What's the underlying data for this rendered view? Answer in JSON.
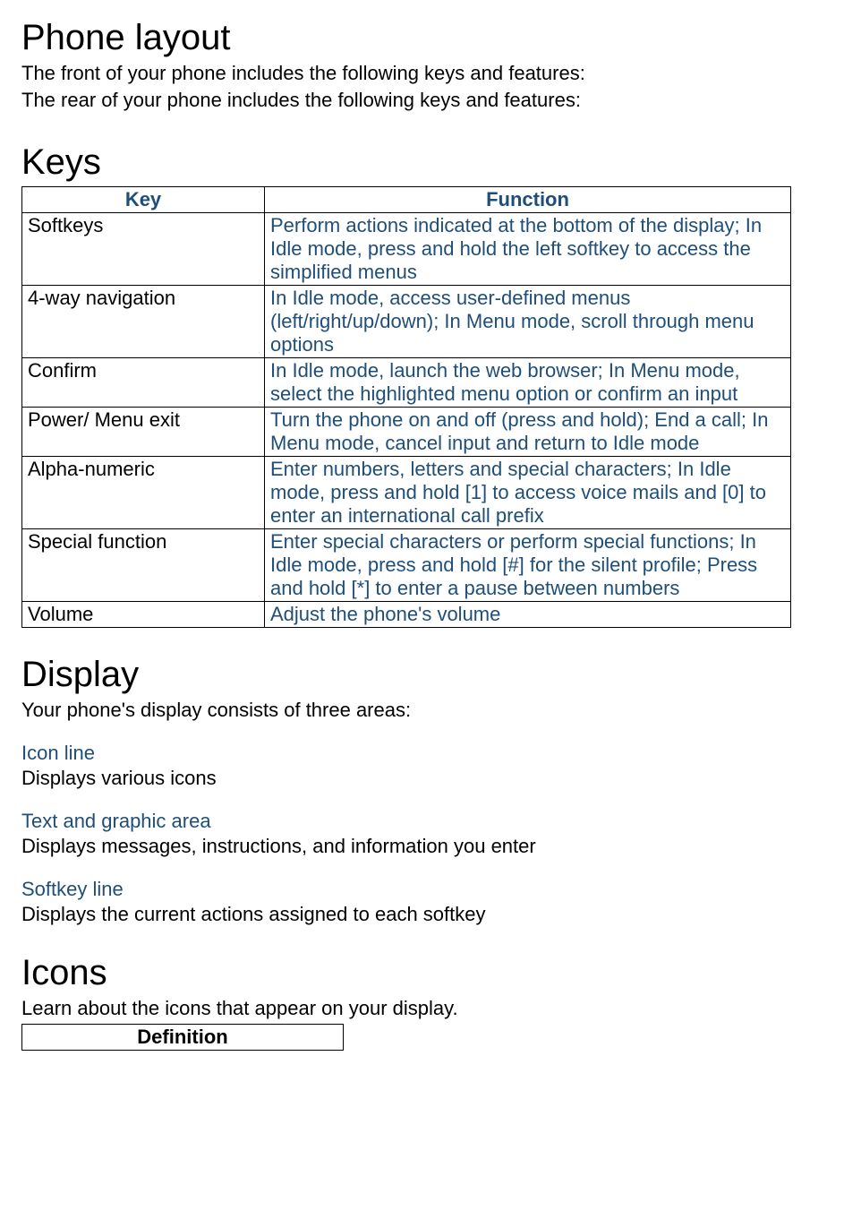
{
  "phone_layout": {
    "heading": "Phone layout",
    "line1": "The front of your phone includes the following keys and features:",
    "line2": "The rear of your phone includes the following keys and features:"
  },
  "keys": {
    "heading": "Keys",
    "header_key": "Key",
    "header_function": "Function",
    "rows": [
      {
        "key": "Softkeys",
        "function": "Perform actions indicated at the bottom of the display; In Idle mode, press and hold the left softkey to access the simplified menus"
      },
      {
        "key": "4-way navigation",
        "function": "In Idle mode, access user-defined menus (left/right/up/down); In Menu mode, scroll through menu options"
      },
      {
        "key": "Confirm",
        "function": "In Idle mode, launch the web browser; In Menu mode, select the highlighted menu option or confirm an input"
      },
      {
        "key": "Power/ Menu exit",
        "function": "Turn the phone on and off (press and hold); End a call; In Menu mode, cancel input and return to Idle mode"
      },
      {
        "key": "Alpha-numeric",
        "function": "Enter numbers, letters and special characters; In Idle mode, press and hold [1] to access voice mails and [0] to enter an international call prefix"
      },
      {
        "key": "Special function",
        "function": "Enter special characters or perform special functions; In Idle mode, press and hold [#] for the silent profile; Press and hold [*] to enter a pause between numbers"
      },
      {
        "key": "Volume",
        "function": "Adjust the phone's volume"
      }
    ]
  },
  "display": {
    "heading": "Display",
    "intro": "Your phone's display consists of three areas:",
    "areas": [
      {
        "title": "Icon line",
        "desc": "Displays various icons"
      },
      {
        "title": "Text and graphic area",
        "desc": "Displays messages, instructions, and information you enter"
      },
      {
        "title": "Softkey line",
        "desc": "Displays the current actions assigned to each softkey"
      }
    ]
  },
  "icons": {
    "heading": "Icons",
    "intro": "Learn about the icons that appear on your display.",
    "header_definition": "Definition"
  }
}
